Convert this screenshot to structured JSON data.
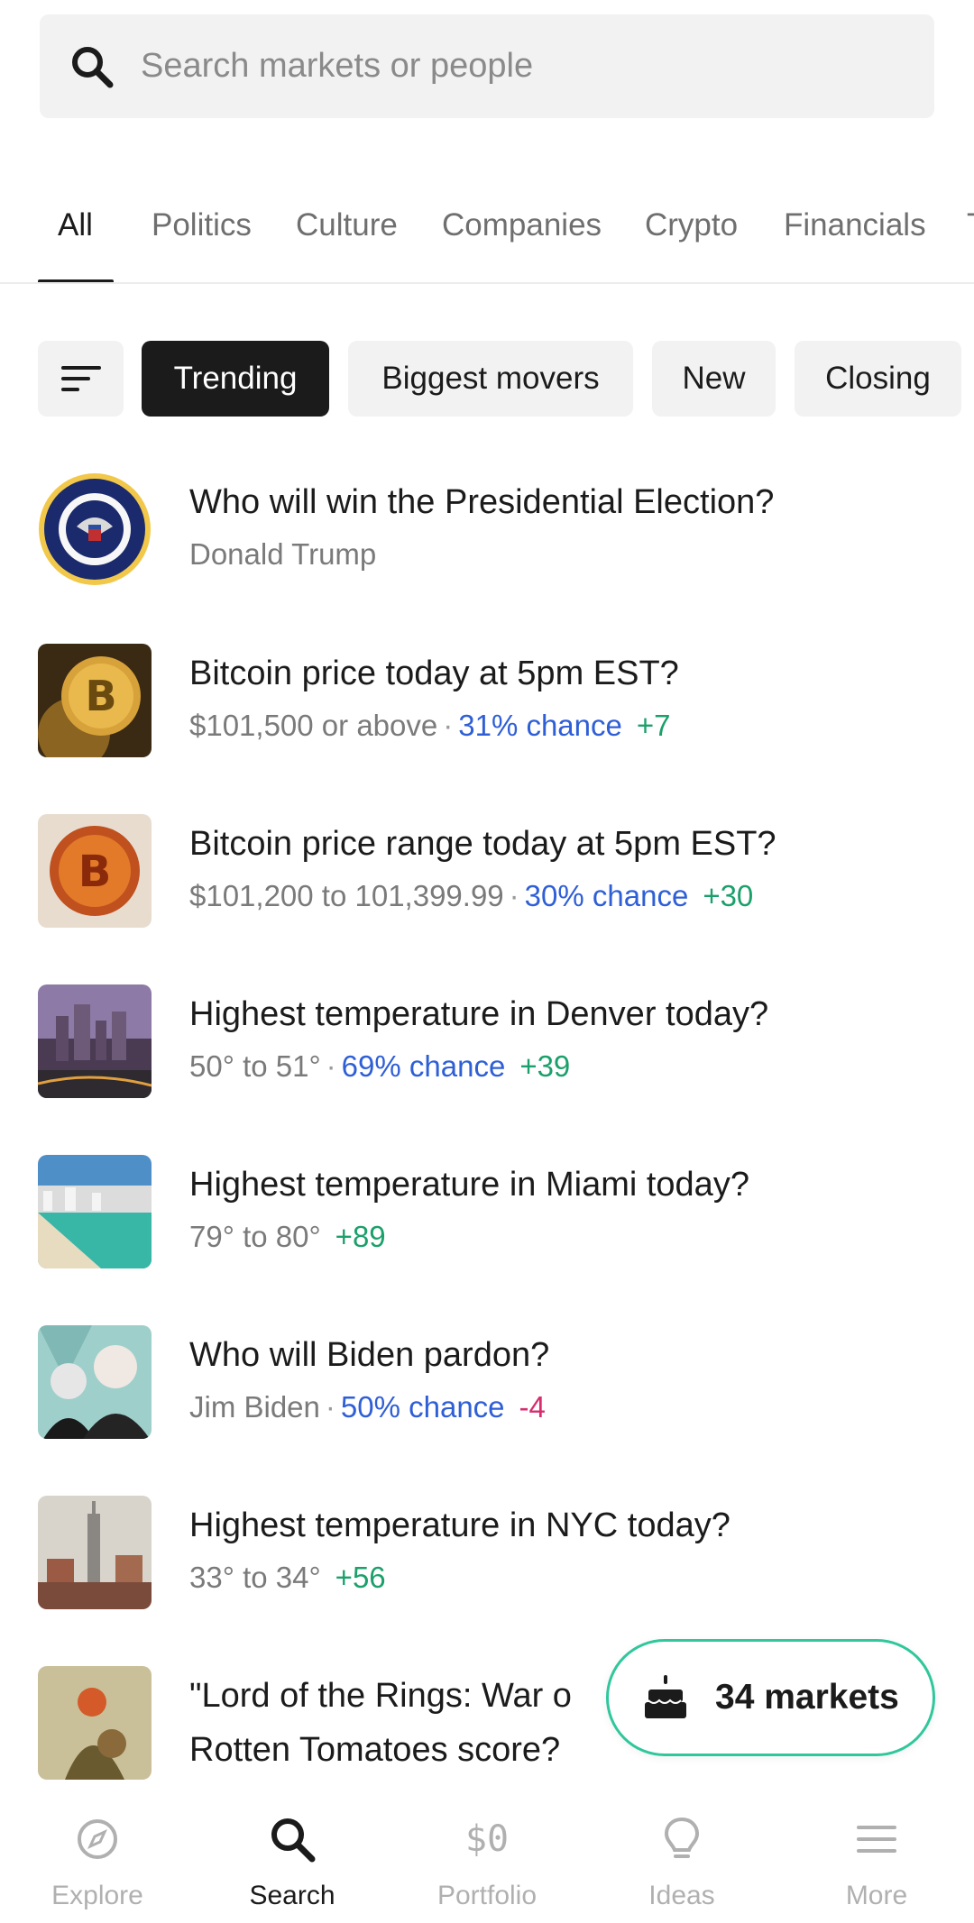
{
  "search": {
    "placeholder": "Search markets or people"
  },
  "tabs": [
    "All",
    "Politics",
    "Culture",
    "Companies",
    "Crypto",
    "Financials",
    "T"
  ],
  "filters": {
    "sort_icon": "sort-icon",
    "chips": [
      "Trending",
      "Biggest movers",
      "New",
      "Closing"
    ]
  },
  "markets": [
    {
      "title": "Who will win the Presidential Election?",
      "outcome": "Donald Trump",
      "chance": "",
      "delta": ""
    },
    {
      "title": "Bitcoin price today at 5pm EST?",
      "outcome": "$101,500 or above",
      "chance": "31% chance",
      "delta": "+7"
    },
    {
      "title": "Bitcoin price range today at 5pm EST?",
      "outcome": "$101,200 to 101,399.99",
      "chance": "30% chance",
      "delta": "+30"
    },
    {
      "title": "Highest temperature in Denver today?",
      "outcome": "50° to 51°",
      "chance": "69% chance",
      "delta": "+39"
    },
    {
      "title": "Highest temperature in Miami today?",
      "outcome": "79° to 80°",
      "chance": "",
      "delta": "+89"
    },
    {
      "title": "Who will Biden pardon?",
      "outcome": "Jim Biden",
      "chance": "50% chance",
      "delta": "-4"
    },
    {
      "title": "Highest temperature in NYC today?",
      "outcome": "33° to 34°",
      "chance": "",
      "delta": "+56"
    },
    {
      "title": "\"Lord of the Rings: War o",
      "title2": "Rotten Tomatoes score?"
    }
  ],
  "pill": {
    "label": "34 markets",
    "icon": "cake-icon"
  },
  "nav": [
    {
      "label": "Explore",
      "icon": "compass-icon"
    },
    {
      "label": "Search",
      "icon": "search-icon"
    },
    {
      "label": "Portfolio",
      "icon": "$0"
    },
    {
      "label": "Ideas",
      "icon": "lightbulb-icon"
    },
    {
      "label": "More",
      "icon": "menu-icon"
    }
  ],
  "colors": {
    "chance": "#2f5fd6",
    "up": "#1ba06b",
    "down": "#d62d6f",
    "pill_border": "#2fc79b"
  }
}
